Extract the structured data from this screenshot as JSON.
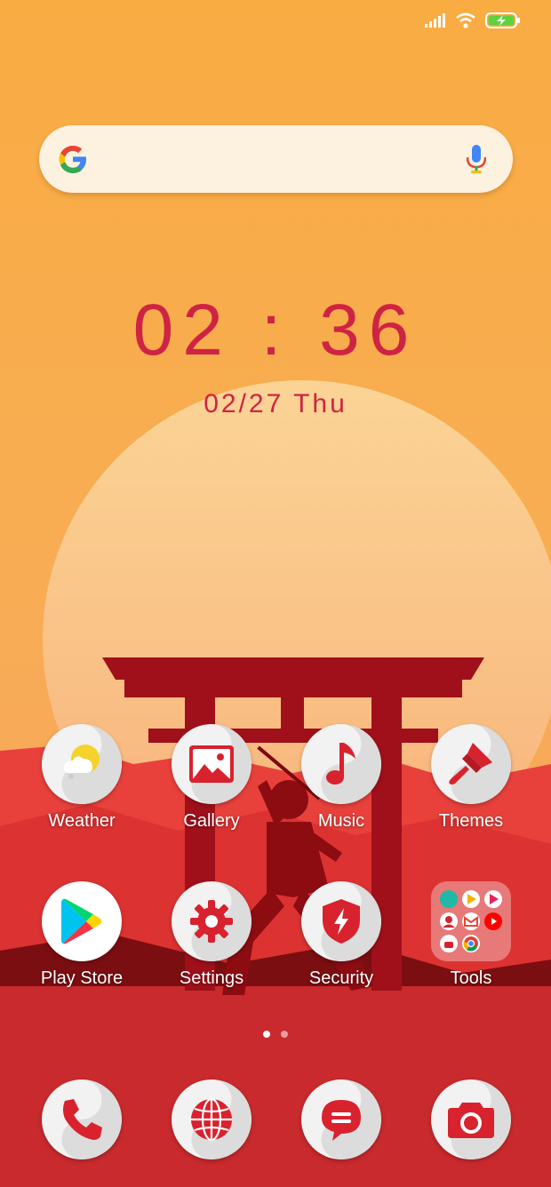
{
  "status_bar": {
    "icons": [
      "signal-icon",
      "wifi-icon",
      "battery-charging-icon"
    ]
  },
  "search": {
    "logo": "google-logo",
    "mic": "microphone-icon"
  },
  "clock": {
    "time": "02 : 36",
    "date": "02/27  Thu"
  },
  "apps_row1": [
    {
      "label": "Weather",
      "icon": "weather-icon"
    },
    {
      "label": "Gallery",
      "icon": "gallery-icon"
    },
    {
      "label": "Music",
      "icon": "music-icon"
    },
    {
      "label": "Themes",
      "icon": "themes-icon"
    }
  ],
  "apps_row2": [
    {
      "label": "Play Store",
      "icon": "play-store-icon"
    },
    {
      "label": "Settings",
      "icon": "settings-icon"
    },
    {
      "label": "Security",
      "icon": "security-icon"
    },
    {
      "label": "Tools",
      "icon": "tools-folder-icon"
    }
  ],
  "dock": [
    {
      "icon": "phone-icon"
    },
    {
      "icon": "browser-icon"
    },
    {
      "icon": "messages-icon"
    },
    {
      "icon": "camera-icon"
    }
  ],
  "page_indicator": {
    "pages": 2,
    "active": 1
  },
  "colors": {
    "accent": "#cf2343",
    "icon_red": "#d8222e",
    "sky_top": "#f7a93f",
    "sun": "#fbd18f"
  }
}
